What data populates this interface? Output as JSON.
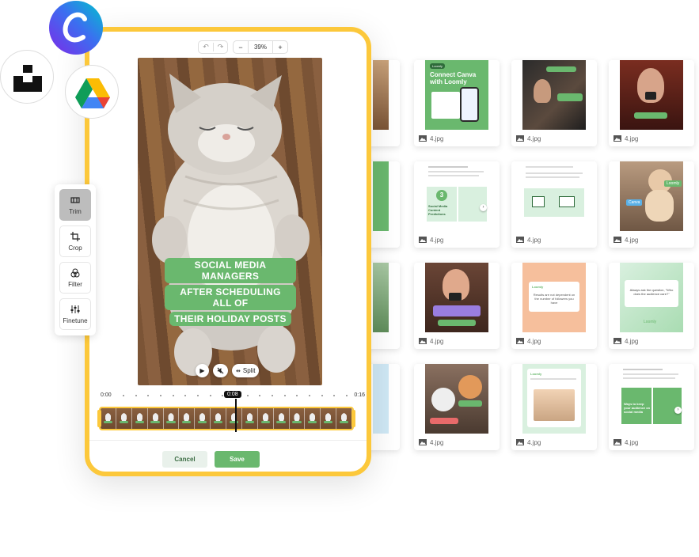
{
  "editor": {
    "undo": "↶",
    "redo": "↷",
    "zoom_out": "−",
    "zoom_level": "39%",
    "zoom_in": "+",
    "caption_lines": [
      "SOCIAL MEDIA MANAGERS",
      "AFTER SCHEDULING ALL OF",
      "THEIR HOLIDAY POSTS"
    ],
    "play": "▶",
    "mute": "🔇",
    "split_label": "Split",
    "timeline_start": "0:00",
    "timeline_current": "0:08",
    "timeline_end": "0:16",
    "cancel_label": "Cancel",
    "save_label": "Save"
  },
  "tools": [
    {
      "label": "Trim",
      "icon": "trim-icon",
      "active": true
    },
    {
      "label": "Crop",
      "icon": "crop-icon",
      "active": false
    },
    {
      "label": "Filter",
      "icon": "filter-icon",
      "active": false
    },
    {
      "label": "Finetune",
      "icon": "finetune-icon",
      "active": false
    }
  ],
  "gallery": {
    "caption": "4.jpg",
    "connect_title": "Connect Canva with Loomly",
    "loomly_badge": "Loomly",
    "canva_badge": "Canva",
    "predictions": "Social Media Content Predictions",
    "predictions_number": "3",
    "thought_text": "Always ask the question, \"Who does the audience care?\"",
    "results_text": "Results are not dependent on the number of followers you have",
    "ways_text": "Ways to keep your audience on social media"
  },
  "logos": [
    "canva-logo",
    "unsplash-logo",
    "google-drive-logo"
  ],
  "colors": {
    "frame": "#fcc83b",
    "accent_green": "#6ab86e",
    "cancel_bg": "#e9f1eb"
  }
}
